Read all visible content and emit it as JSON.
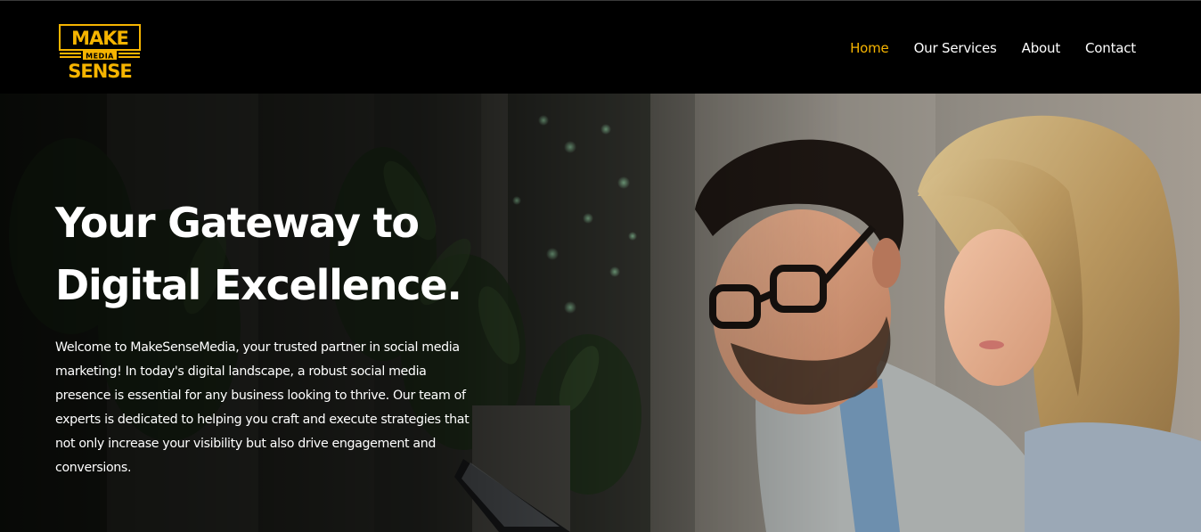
{
  "brand": {
    "logo_text_top": "MAKE",
    "logo_text_middle": "MEDIA",
    "logo_text_bottom": "SENSE",
    "accent_color": "#f6b400"
  },
  "nav": {
    "items": [
      {
        "label": "Home",
        "active": true
      },
      {
        "label": "Our Services",
        "active": false
      },
      {
        "label": "About",
        "active": false
      },
      {
        "label": "Contact",
        "active": false
      }
    ]
  },
  "hero": {
    "title_line1": "Your Gateway to",
    "title_line2": "Digital Excellence.",
    "body": "Welcome to MakeSenseMedia, your trusted partner in social media marketing! In today's digital landscape, a robust social media presence is essential for any business looking to thrive. Our team of experts is dedicated to helping you craft and execute strategies that not only increase your visibility but also drive engagement and conversions."
  }
}
